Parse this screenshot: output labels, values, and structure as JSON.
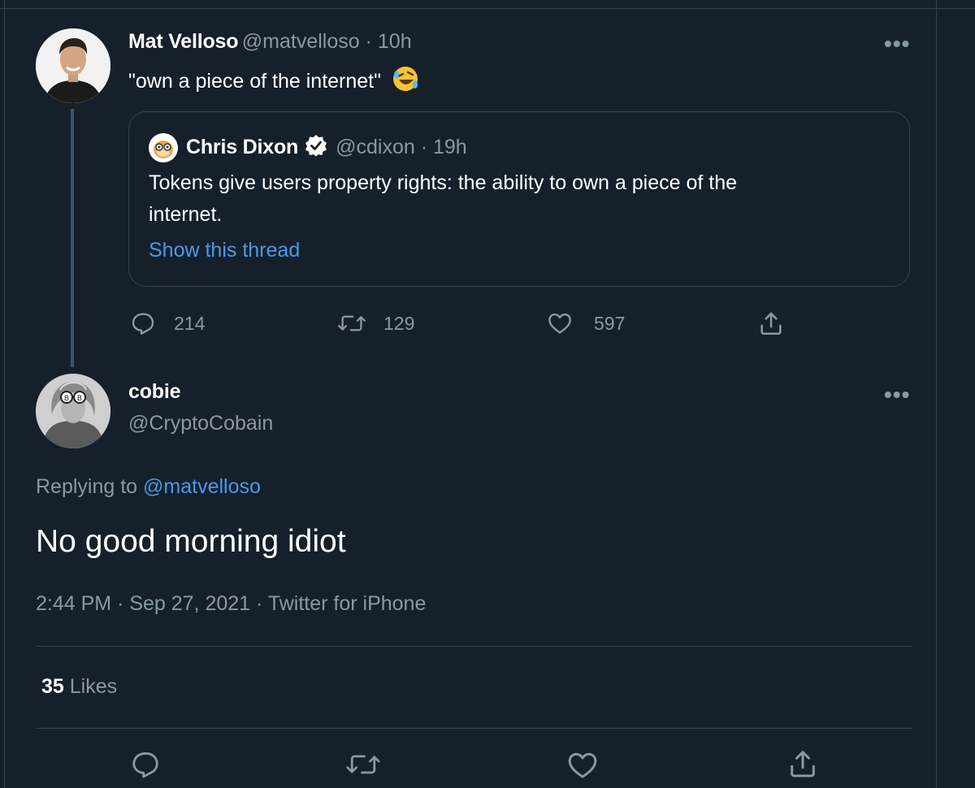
{
  "parent_tweet": {
    "author_name": "Mat Velloso",
    "handle_time": "@matvelloso · 10h",
    "text": "\"own a piece of the internet\"",
    "emoji": "🤣",
    "more_icon": "more-horizontal-icon",
    "quote": {
      "author_name": "Chris Dixon",
      "verified_icon": "verified-badge-icon",
      "handle_time": "@cdixon · 19h",
      "text_line1": "Tokens give users property rights: the ability to own a piece of the",
      "text_line2": "internet.",
      "show_thread": "Show this thread"
    },
    "actions": {
      "reply_count": "214",
      "retweet_count": "129",
      "like_count": "597"
    }
  },
  "main_tweet": {
    "author_name": "cobie",
    "handle": "@CryptoCobain",
    "replying_prefix": "Replying to ",
    "replying_handle": "@matvelloso",
    "text": "No good morning idiot",
    "meta": "2:44 PM · Sep 27, 2021 · Twitter for iPhone",
    "likes_count": "35",
    "likes_label": "Likes"
  },
  "colors": {
    "background": "#15202b",
    "border": "#38444d",
    "muted": "#8899a6",
    "link": "#1d9bf0"
  }
}
